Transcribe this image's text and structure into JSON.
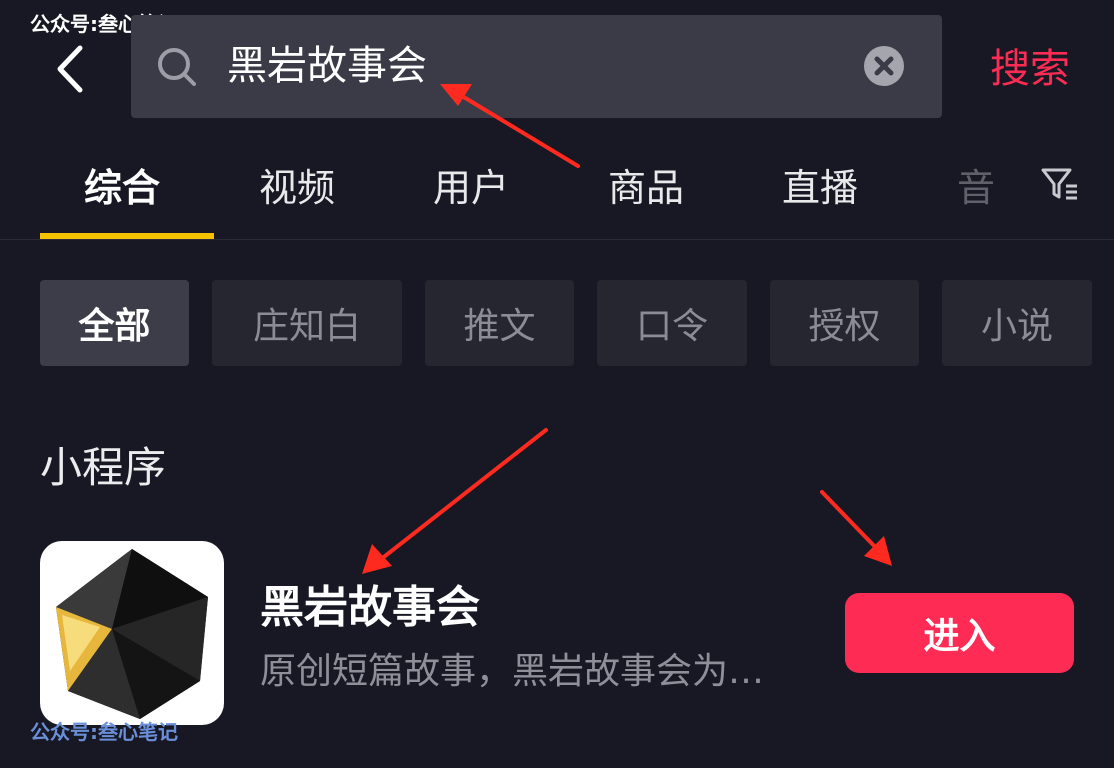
{
  "watermark": {
    "top": "公众号:叁心笔记",
    "bottom": "公众号:叁心笔记"
  },
  "header": {
    "back_icon": "chevron-left-icon",
    "search": {
      "icon": "search-icon",
      "value": "黑岩故事会",
      "clear_icon": "clear-icon"
    },
    "submit_label": "搜索"
  },
  "tabs": [
    {
      "label": "综合",
      "active": true
    },
    {
      "label": "视频"
    },
    {
      "label": "用户"
    },
    {
      "label": "商品"
    },
    {
      "label": "直播"
    },
    {
      "label": "音"
    }
  ],
  "filter_icon": "filter-icon",
  "chips": [
    {
      "label": "全部",
      "active": true
    },
    {
      "label": "庄知白"
    },
    {
      "label": "推文"
    },
    {
      "label": "口令"
    },
    {
      "label": "授权"
    },
    {
      "label": "小说"
    }
  ],
  "section": {
    "title": "小程序"
  },
  "mini_program": {
    "icon": "dark-polyhedron-logo",
    "name": "黑岩故事会",
    "description": "原创短篇故事，黑岩故事会为…",
    "action_label": "进入"
  },
  "colors": {
    "background": "#171823",
    "accent": "#fe2c55",
    "tab_indicator": "#f5c200",
    "annotation_arrow": "#ff2a1f"
  }
}
